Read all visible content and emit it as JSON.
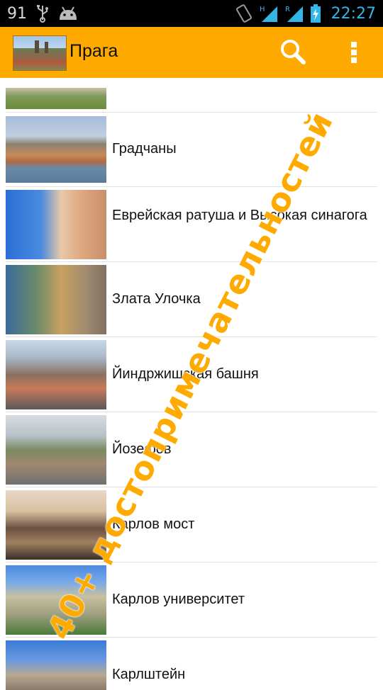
{
  "status_bar": {
    "notification_count": "91",
    "time": "22:27",
    "icons": [
      "usb-icon",
      "android-icon",
      "rotation-icon",
      "signal-h-icon",
      "signal-r-icon",
      "battery-charging-icon"
    ]
  },
  "action_bar": {
    "title": "Прага",
    "icons": [
      "app-thumbnail",
      "search-icon",
      "overflow-menu-icon"
    ]
  },
  "list": {
    "items": [
      {
        "label": ""
      },
      {
        "label": "Градчаны"
      },
      {
        "label": "Еврейская ратуша и Высокая синагога"
      },
      {
        "label": "Злата Улочка"
      },
      {
        "label": "Йиндржишская башня"
      },
      {
        "label": "Йозефов"
      },
      {
        "label": "Карлов мост"
      },
      {
        "label": "Карлов университет"
      },
      {
        "label": "Карлштейн"
      }
    ]
  },
  "promo_text": "40+ достопримечательностей",
  "colors": {
    "accent": "#ffaa00",
    "status_bar": "#000000",
    "clock": "#33b5e5"
  }
}
